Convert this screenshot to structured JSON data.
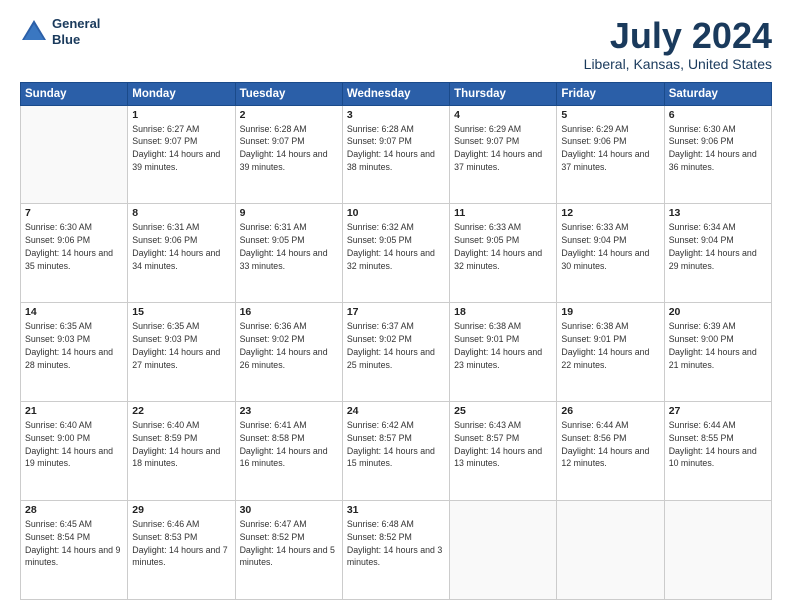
{
  "header": {
    "logo_line1": "General",
    "logo_line2": "Blue",
    "main_title": "July 2024",
    "subtitle": "Liberal, Kansas, United States"
  },
  "calendar": {
    "days_of_week": [
      "Sunday",
      "Monday",
      "Tuesday",
      "Wednesday",
      "Thursday",
      "Friday",
      "Saturday"
    ],
    "weeks": [
      [
        {
          "day": "",
          "sunrise": "",
          "sunset": "",
          "daylight": ""
        },
        {
          "day": "1",
          "sunrise": "Sunrise: 6:27 AM",
          "sunset": "Sunset: 9:07 PM",
          "daylight": "Daylight: 14 hours and 39 minutes."
        },
        {
          "day": "2",
          "sunrise": "Sunrise: 6:28 AM",
          "sunset": "Sunset: 9:07 PM",
          "daylight": "Daylight: 14 hours and 39 minutes."
        },
        {
          "day": "3",
          "sunrise": "Sunrise: 6:28 AM",
          "sunset": "Sunset: 9:07 PM",
          "daylight": "Daylight: 14 hours and 38 minutes."
        },
        {
          "day": "4",
          "sunrise": "Sunrise: 6:29 AM",
          "sunset": "Sunset: 9:07 PM",
          "daylight": "Daylight: 14 hours and 37 minutes."
        },
        {
          "day": "5",
          "sunrise": "Sunrise: 6:29 AM",
          "sunset": "Sunset: 9:06 PM",
          "daylight": "Daylight: 14 hours and 37 minutes."
        },
        {
          "day": "6",
          "sunrise": "Sunrise: 6:30 AM",
          "sunset": "Sunset: 9:06 PM",
          "daylight": "Daylight: 14 hours and 36 minutes."
        }
      ],
      [
        {
          "day": "7",
          "sunrise": "Sunrise: 6:30 AM",
          "sunset": "Sunset: 9:06 PM",
          "daylight": "Daylight: 14 hours and 35 minutes."
        },
        {
          "day": "8",
          "sunrise": "Sunrise: 6:31 AM",
          "sunset": "Sunset: 9:06 PM",
          "daylight": "Daylight: 14 hours and 34 minutes."
        },
        {
          "day": "9",
          "sunrise": "Sunrise: 6:31 AM",
          "sunset": "Sunset: 9:05 PM",
          "daylight": "Daylight: 14 hours and 33 minutes."
        },
        {
          "day": "10",
          "sunrise": "Sunrise: 6:32 AM",
          "sunset": "Sunset: 9:05 PM",
          "daylight": "Daylight: 14 hours and 32 minutes."
        },
        {
          "day": "11",
          "sunrise": "Sunrise: 6:33 AM",
          "sunset": "Sunset: 9:05 PM",
          "daylight": "Daylight: 14 hours and 32 minutes."
        },
        {
          "day": "12",
          "sunrise": "Sunrise: 6:33 AM",
          "sunset": "Sunset: 9:04 PM",
          "daylight": "Daylight: 14 hours and 30 minutes."
        },
        {
          "day": "13",
          "sunrise": "Sunrise: 6:34 AM",
          "sunset": "Sunset: 9:04 PM",
          "daylight": "Daylight: 14 hours and 29 minutes."
        }
      ],
      [
        {
          "day": "14",
          "sunrise": "Sunrise: 6:35 AM",
          "sunset": "Sunset: 9:03 PM",
          "daylight": "Daylight: 14 hours and 28 minutes."
        },
        {
          "day": "15",
          "sunrise": "Sunrise: 6:35 AM",
          "sunset": "Sunset: 9:03 PM",
          "daylight": "Daylight: 14 hours and 27 minutes."
        },
        {
          "day": "16",
          "sunrise": "Sunrise: 6:36 AM",
          "sunset": "Sunset: 9:02 PM",
          "daylight": "Daylight: 14 hours and 26 minutes."
        },
        {
          "day": "17",
          "sunrise": "Sunrise: 6:37 AM",
          "sunset": "Sunset: 9:02 PM",
          "daylight": "Daylight: 14 hours and 25 minutes."
        },
        {
          "day": "18",
          "sunrise": "Sunrise: 6:38 AM",
          "sunset": "Sunset: 9:01 PM",
          "daylight": "Daylight: 14 hours and 23 minutes."
        },
        {
          "day": "19",
          "sunrise": "Sunrise: 6:38 AM",
          "sunset": "Sunset: 9:01 PM",
          "daylight": "Daylight: 14 hours and 22 minutes."
        },
        {
          "day": "20",
          "sunrise": "Sunrise: 6:39 AM",
          "sunset": "Sunset: 9:00 PM",
          "daylight": "Daylight: 14 hours and 21 minutes."
        }
      ],
      [
        {
          "day": "21",
          "sunrise": "Sunrise: 6:40 AM",
          "sunset": "Sunset: 9:00 PM",
          "daylight": "Daylight: 14 hours and 19 minutes."
        },
        {
          "day": "22",
          "sunrise": "Sunrise: 6:40 AM",
          "sunset": "Sunset: 8:59 PM",
          "daylight": "Daylight: 14 hours and 18 minutes."
        },
        {
          "day": "23",
          "sunrise": "Sunrise: 6:41 AM",
          "sunset": "Sunset: 8:58 PM",
          "daylight": "Daylight: 14 hours and 16 minutes."
        },
        {
          "day": "24",
          "sunrise": "Sunrise: 6:42 AM",
          "sunset": "Sunset: 8:57 PM",
          "daylight": "Daylight: 14 hours and 15 minutes."
        },
        {
          "day": "25",
          "sunrise": "Sunrise: 6:43 AM",
          "sunset": "Sunset: 8:57 PM",
          "daylight": "Daylight: 14 hours and 13 minutes."
        },
        {
          "day": "26",
          "sunrise": "Sunrise: 6:44 AM",
          "sunset": "Sunset: 8:56 PM",
          "daylight": "Daylight: 14 hours and 12 minutes."
        },
        {
          "day": "27",
          "sunrise": "Sunrise: 6:44 AM",
          "sunset": "Sunset: 8:55 PM",
          "daylight": "Daylight: 14 hours and 10 minutes."
        }
      ],
      [
        {
          "day": "28",
          "sunrise": "Sunrise: 6:45 AM",
          "sunset": "Sunset: 8:54 PM",
          "daylight": "Daylight: 14 hours and 9 minutes."
        },
        {
          "day": "29",
          "sunrise": "Sunrise: 6:46 AM",
          "sunset": "Sunset: 8:53 PM",
          "daylight": "Daylight: 14 hours and 7 minutes."
        },
        {
          "day": "30",
          "sunrise": "Sunrise: 6:47 AM",
          "sunset": "Sunset: 8:52 PM",
          "daylight": "Daylight: 14 hours and 5 minutes."
        },
        {
          "day": "31",
          "sunrise": "Sunrise: 6:48 AM",
          "sunset": "Sunset: 8:52 PM",
          "daylight": "Daylight: 14 hours and 3 minutes."
        },
        {
          "day": "",
          "sunrise": "",
          "sunset": "",
          "daylight": ""
        },
        {
          "day": "",
          "sunrise": "",
          "sunset": "",
          "daylight": ""
        },
        {
          "day": "",
          "sunrise": "",
          "sunset": "",
          "daylight": ""
        }
      ]
    ]
  }
}
